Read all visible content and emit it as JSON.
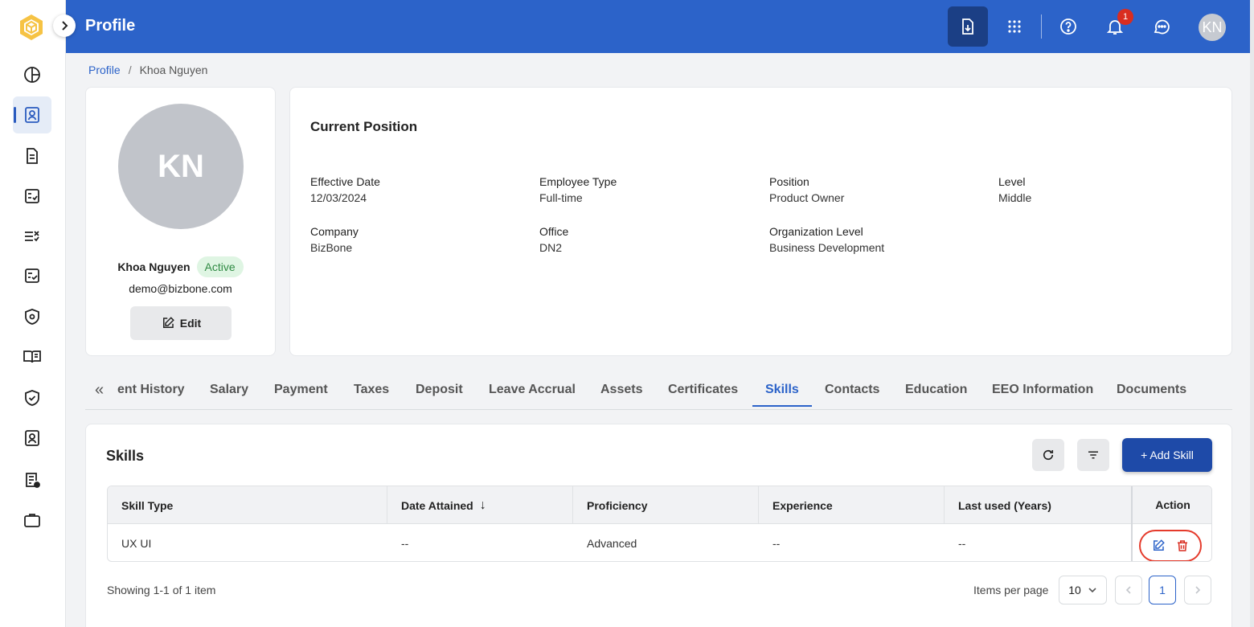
{
  "app": {
    "title": "Profile",
    "user_initials": "KN",
    "notification_count": "1"
  },
  "breadcrumb": {
    "root": "Profile",
    "separator": "/",
    "current": "Khoa Nguyen"
  },
  "profile": {
    "initials": "KN",
    "name": "Khoa Nguyen",
    "status": "Active",
    "email": "demo@bizbone.com",
    "edit_label": "Edit"
  },
  "position": {
    "heading": "Current Position",
    "fields": [
      {
        "label": "Effective Date",
        "value": "12/03/2024"
      },
      {
        "label": "Employee Type",
        "value": "Full-time"
      },
      {
        "label": "Position",
        "value": "Product Owner"
      },
      {
        "label": "Level",
        "value": "Middle"
      },
      {
        "label": "Company",
        "value": "BizBone"
      },
      {
        "label": "Office",
        "value": "DN2"
      },
      {
        "label": "Organization Level",
        "value": "Business Development"
      }
    ]
  },
  "tabs": {
    "scroll_left": "«",
    "items": [
      "ent History",
      "Salary",
      "Payment",
      "Taxes",
      "Deposit",
      "Leave Accrual",
      "Assets",
      "Certificates",
      "Skills",
      "Contacts",
      "Education",
      "EEO Information",
      "Documents"
    ],
    "active": "Skills"
  },
  "skills": {
    "heading": "Skills",
    "add_label": "+ Add Skill",
    "columns": [
      "Skill Type",
      "Date Attained",
      "Proficiency",
      "Experience",
      "Last used (Years)",
      "Action"
    ],
    "sort_indicator": "↓",
    "rows": [
      {
        "skill_type": "UX UI",
        "date_attained": "--",
        "proficiency": "Advanced",
        "experience": "--",
        "last_used": "--"
      }
    ],
    "showing": "Showing 1-1 of 1 item",
    "items_per_page_label": "Items per page",
    "items_per_page": "10",
    "current_page": "1"
  },
  "colors": {
    "brand": "#2c63c9",
    "primary_button": "#1e4aa8",
    "active_status_bg": "#dff5e3",
    "delete": "#d92d20",
    "highlight_ring": "#e53b2c"
  },
  "icons": {
    "rail": [
      "dashboard-icon",
      "profile-icon",
      "document-icon",
      "checklist-icon",
      "tasks-icon",
      "approval-icon",
      "security-badge-icon",
      "book-icon",
      "shield-check-icon",
      "id-card-icon",
      "report-icon",
      "briefcase-icon"
    ],
    "top": [
      "download-icon",
      "apps-grid-icon",
      "help-icon",
      "bell-icon",
      "chat-icon"
    ]
  }
}
